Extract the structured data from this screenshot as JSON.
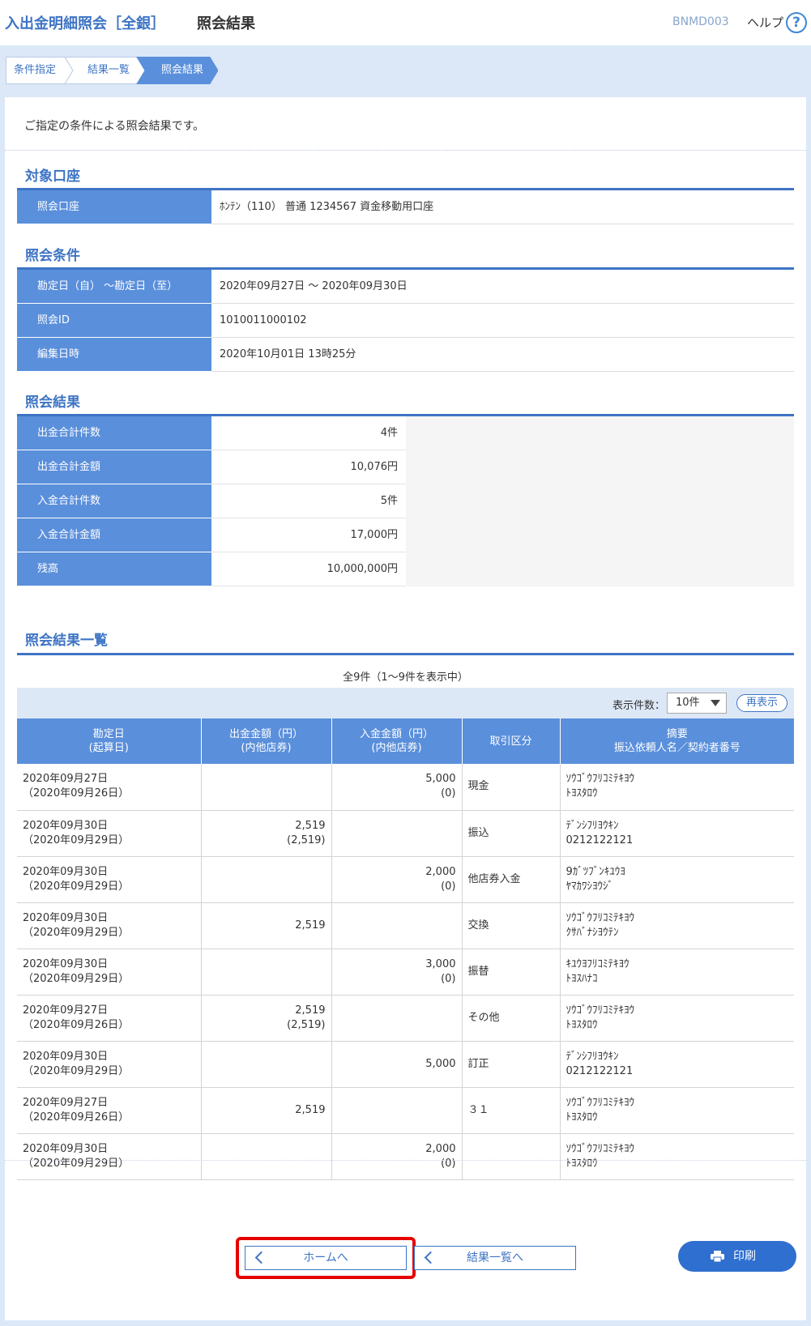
{
  "header": {
    "title": "入出金明細照会［全銀］",
    "subtitle": "照会結果",
    "screen_code": "BNMD003",
    "help_label": "ヘルプ",
    "help_icon_glyph": "?"
  },
  "breadcrumb": [
    {
      "label": "条件指定",
      "active": false
    },
    {
      "label": "結果一覧",
      "active": false
    },
    {
      "label": "照会結果",
      "active": true
    }
  ],
  "intro": "ご指定の条件による照会結果です。",
  "account_section": {
    "title": "対象口座",
    "rows": [
      {
        "label": "照会口座",
        "value": "ﾎﾝﾃﾝ（110） 普通 1234567 資金移動用口座"
      }
    ]
  },
  "condition_section": {
    "title": "照会条件",
    "rows": [
      {
        "label": "勘定日（自） ～勘定日（至）",
        "value": "2020年09月27日 ～ 2020年09月30日"
      },
      {
        "label": "照会ID",
        "value": "1010011000102"
      },
      {
        "label": "編集日時",
        "value": "2020年10月01日 13時25分"
      }
    ]
  },
  "summary_section": {
    "title": "照会結果",
    "rows": [
      {
        "label": "出金合計件数",
        "value": "4件"
      },
      {
        "label": "出金合計金額",
        "value": "10,076円"
      },
      {
        "label": "入金合計件数",
        "value": "5件"
      },
      {
        "label": "入金合計金額",
        "value": "17,000円"
      },
      {
        "label": "残高",
        "value": "10,000,000円"
      }
    ]
  },
  "list_section": {
    "title": "照会結果一覧",
    "count_text": "全9件（1～9件を表示中）",
    "display_count_label": "表示件数：",
    "display_count_value": "10件",
    "redisplay_label": "再表示",
    "columns": [
      {
        "line1": "勘定日",
        "line2": "(起算日)"
      },
      {
        "line1": "出金金額（円）",
        "line2": "(内他店券)"
      },
      {
        "line1": "入金金額（円）",
        "line2": "(内他店券)"
      },
      {
        "line1": "取引区分",
        "line2": ""
      },
      {
        "line1": "摘要",
        "line2": "振込依頼人名／契約者番号"
      }
    ],
    "rows": [
      {
        "date": "2020年09月27日",
        "value_date": "（2020年09月26日）",
        "out_amount": "",
        "out_other": "",
        "in_amount": "5,000",
        "in_other": "(0)",
        "type": "現金",
        "memo1": "ｿｳｺﾞｳﾌﾘｺﾐﾃｷﾖｳ",
        "memo2": "ﾄﾖｽﾀﾛｳ"
      },
      {
        "date": "2020年09月30日",
        "value_date": "（2020年09月29日）",
        "out_amount": "2,519",
        "out_other": "(2,519)",
        "in_amount": "",
        "in_other": "",
        "type": "振込",
        "memo1": "ﾃﾞﾝｼﾌﾘﾖｳｷﾝ",
        "memo2": "0212122121"
      },
      {
        "date": "2020年09月30日",
        "value_date": "（2020年09月29日）",
        "out_amount": "",
        "out_other": "",
        "in_amount": "2,000",
        "in_other": "(0)",
        "type": "他店券入金",
        "memo1": "9ｶﾞﾂﾌﾞﾝｷﾕｳﾖ",
        "memo2": "ﾔﾏｶﾜｼﾖｳｼﾞ"
      },
      {
        "date": "2020年09月30日",
        "value_date": "（2020年09月29日）",
        "out_amount": "2,519",
        "out_other": "",
        "in_amount": "",
        "in_other": "",
        "type": "交換",
        "memo1": "ｿｳｺﾞｳﾌﾘｺﾐﾃｷﾖｳ",
        "memo2": "ｸｻﾊﾞﾅｼﾖｳﾃﾝ"
      },
      {
        "date": "2020年09月30日",
        "value_date": "（2020年09月29日）",
        "out_amount": "",
        "out_other": "",
        "in_amount": "3,000",
        "in_other": "(0)",
        "type": "振替",
        "memo1": "ｷﾕｳﾖﾌﾘｺﾐﾃｷﾖｳ",
        "memo2": "ﾄﾖｽﾊﾅｺ"
      },
      {
        "date": "2020年09月27日",
        "value_date": "（2020年09月26日）",
        "out_amount": "2,519",
        "out_other": "(2,519)",
        "in_amount": "",
        "in_other": "",
        "type": "その他",
        "memo1": "ｿｳｺﾞｳﾌﾘｺﾐﾃｷﾖｳ",
        "memo2": "ﾄﾖｽﾀﾛｳ"
      },
      {
        "date": "2020年09月30日",
        "value_date": "（2020年09月29日）",
        "out_amount": "",
        "out_other": "",
        "in_amount": "5,000",
        "in_other": "",
        "type": "訂正",
        "memo1": "ﾃﾞﾝｼﾌﾘﾖｳｷﾝ",
        "memo2": "0212122121"
      },
      {
        "date": "2020年09月27日",
        "value_date": "（2020年09月26日）",
        "out_amount": "2,519",
        "out_other": "",
        "in_amount": "",
        "in_other": "",
        "type": "３１",
        "memo1": "ｿｳｺﾞｳﾌﾘｺﾐﾃｷﾖｳ",
        "memo2": "ﾄﾖｽﾀﾛｳ"
      },
      {
        "date": "2020年09月30日",
        "value_date": "（2020年09月29日）",
        "out_amount": "",
        "out_other": "",
        "in_amount": "2,000",
        "in_other": "(0)",
        "type": "",
        "memo1": "ｿｳｺﾞｳﾌﾘｺﾐﾃｷﾖｳ",
        "memo2": "ﾄﾖｽﾀﾛｳ"
      }
    ]
  },
  "buttons": {
    "home": "ホームへ",
    "back_to_list": "結果一覧へ",
    "print": "印刷"
  },
  "colors": {
    "accent": "#3e74c4",
    "label_bg": "#5a8fdb",
    "highlight": "#e60000",
    "print_button": "#2f6fcf"
  }
}
